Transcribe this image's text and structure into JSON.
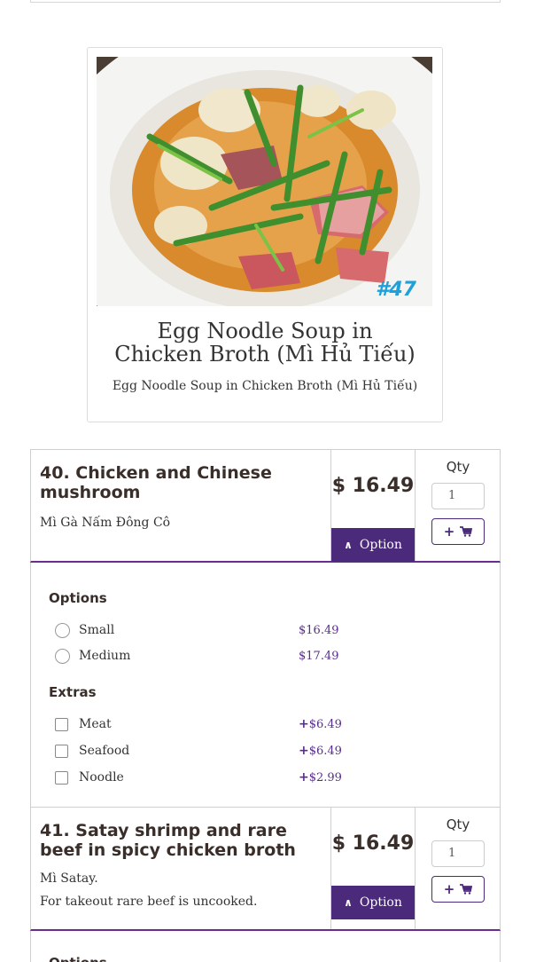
{
  "featured": {
    "title": "Egg Noodle Soup in Chicken Broth (Mì Hủ Tiếu)",
    "subtitle": "Egg Noodle Soup in Chicken Broth (Mì Hủ Tiếu)",
    "photo_badge": "#47"
  },
  "items": [
    {
      "name": "40. Chicken and Chinese mushroom",
      "desc_lines": [
        "Mì Gà Nấm Đông Cô"
      ],
      "price": "$ 16.49",
      "option_label": "Option",
      "qty_label": "Qty",
      "qty_value": "1"
    },
    {
      "name": "41. Satay shrimp and rare beef in spicy chicken broth",
      "desc_lines": [
        "Mì Satay.",
        "For takeout rare beef is uncooked."
      ],
      "price": "$ 16.49",
      "option_label": "Option",
      "qty_label": "Qty",
      "qty_value": "1"
    }
  ],
  "options_panel": {
    "options_title": "Options",
    "options": [
      {
        "label": "Small",
        "price": "$16.49"
      },
      {
        "label": "Medium",
        "price": "$17.49"
      }
    ],
    "extras_title": "Extras",
    "extras": [
      {
        "label": "Meat",
        "price": "$6.49"
      },
      {
        "label": "Seafood",
        "price": "$6.49"
      },
      {
        "label": "Noodle",
        "price": "$2.99"
      }
    ]
  },
  "next_panel_peek": "Options",
  "colors": {
    "accent": "#4b2a7b",
    "price_text": "#5a2d8f",
    "divider": "#6b2c8e"
  }
}
